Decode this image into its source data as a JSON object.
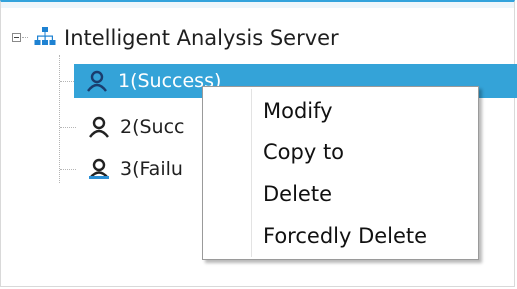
{
  "tree": {
    "root": {
      "label": "Intelligent Analysis Server",
      "icon": "network-icon",
      "expanded": true
    },
    "nodes": [
      {
        "label": "1(Success)",
        "icon": "user-icon",
        "selected": true
      },
      {
        "label": "2(Succ",
        "icon": "user-icon",
        "selected": false
      },
      {
        "label": "3(Failu",
        "icon": "user-warning-icon",
        "selected": false
      }
    ]
  },
  "context_menu": {
    "items": [
      "Modify",
      "Copy to",
      "Delete",
      "Forcedly Delete"
    ]
  },
  "colors": {
    "selection": "#34a3d8",
    "accent_border": "#33a3dc",
    "icon_blue": "#1e82d2"
  }
}
